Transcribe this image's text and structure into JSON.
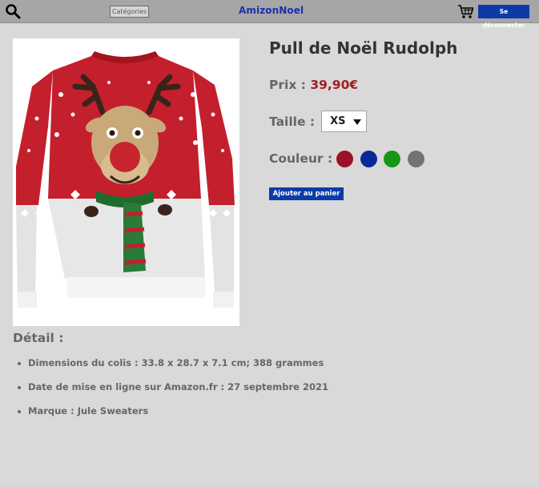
{
  "header": {
    "categories_label": "Catégories",
    "logo": "AmizonNoel",
    "logout_label": "Se déconnecter",
    "search_icon": "search-icon",
    "cart_icon": "cart-icon"
  },
  "product": {
    "title": "Pull de Noël Rudolph",
    "image_alt": "Pull de Noël Rudolph",
    "price_label": "Prix :",
    "price_value": "39,90€",
    "size_label": "Taille :",
    "size_value": "XS",
    "color_label": "Couleur :",
    "colors": [
      "#9b1226",
      "#0a2a9a",
      "#179617",
      "#737373"
    ],
    "add_to_cart_label": "Ajouter au panier"
  },
  "details": {
    "title": "Détail :",
    "items": [
      "Dimensions du colis  :  33.8 x 28.7 x 7.1 cm; 388 grammes",
      "Date de mise en ligne sur Amazon.fr  :  27 septembre 2021",
      "Marque : Jule Sweaters"
    ]
  },
  "theme": {
    "accent": "#0d3aa8",
    "price_color": "#a31d22"
  }
}
